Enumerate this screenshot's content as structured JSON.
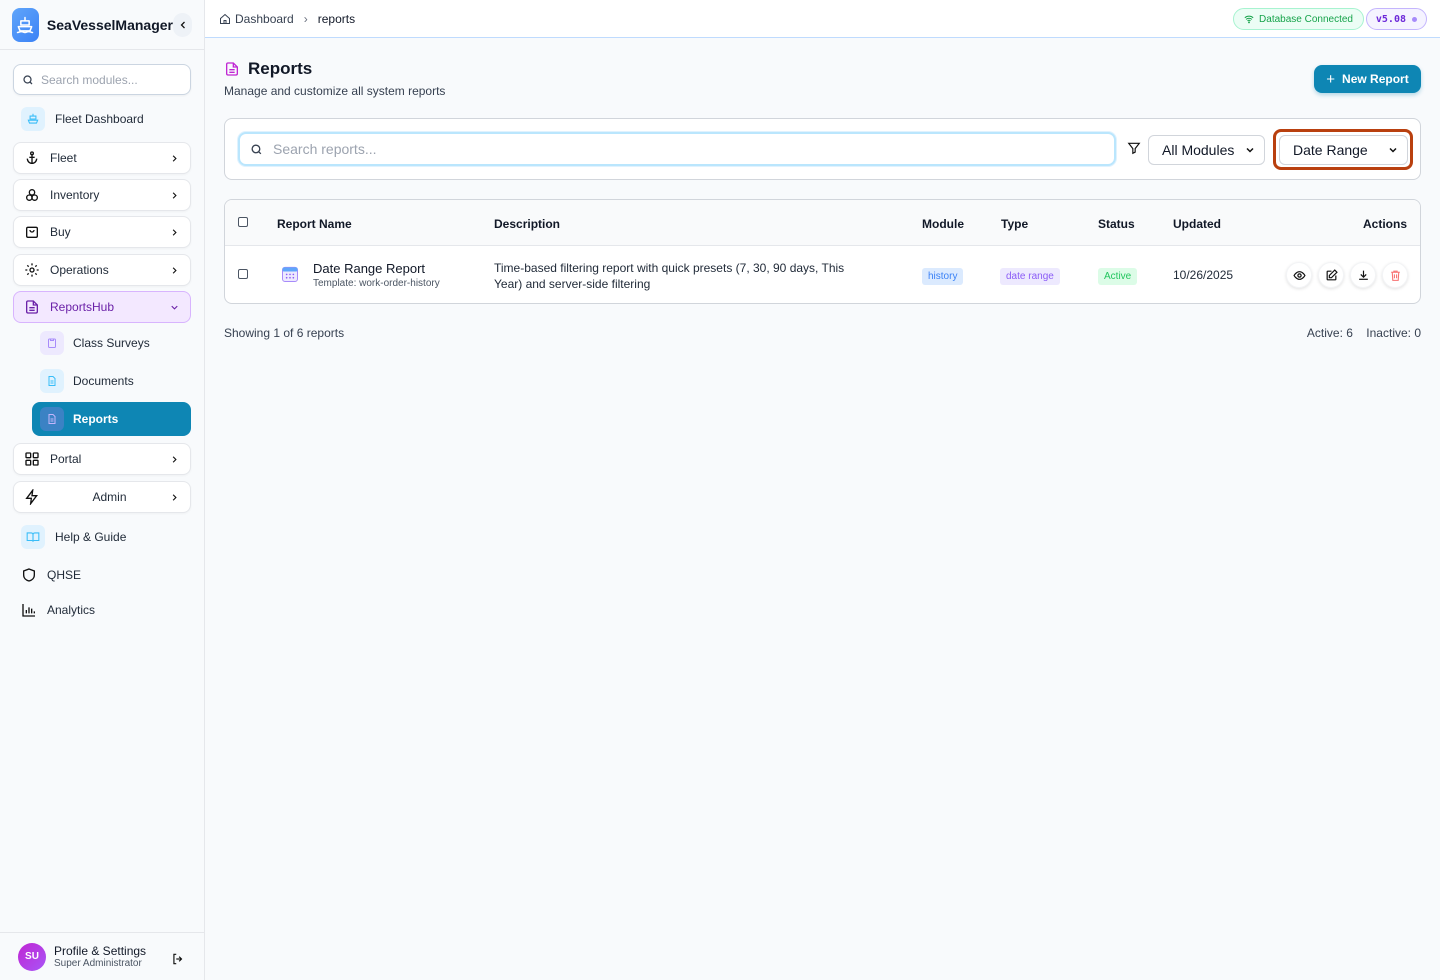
{
  "brand": {
    "name": "SeaVesselManager"
  },
  "sidebar": {
    "search_placeholder": "Search modules...",
    "items": [
      {
        "label": "Fleet Dashboard"
      },
      {
        "label": "Fleet"
      },
      {
        "label": "Inventory"
      },
      {
        "label": "Buy"
      },
      {
        "label": "Operations"
      },
      {
        "label": "ReportsHub"
      },
      {
        "label": "Portal"
      },
      {
        "label": "Admin"
      },
      {
        "label": "Help & Guide"
      },
      {
        "label": "QHSE"
      },
      {
        "label": "Analytics"
      }
    ],
    "subitems": [
      {
        "label": "Class Surveys"
      },
      {
        "label": "Documents"
      },
      {
        "label": "Reports"
      }
    ]
  },
  "profile": {
    "initials": "SU",
    "name": "Profile & Settings",
    "role": "Super Administrator"
  },
  "breadcrumb": {
    "home": "Dashboard",
    "current": "reports"
  },
  "status": {
    "db": "Database Connected",
    "version": "v5.08"
  },
  "page": {
    "title": "Reports",
    "subtitle": "Manage and customize all system reports",
    "new_button": "New Report"
  },
  "filters": {
    "search_placeholder": "Search reports...",
    "module_selected": "All Modules",
    "type_selected": "Date Range"
  },
  "table": {
    "headers": [
      "Report Name",
      "Description",
      "Module",
      "Type",
      "Status",
      "Updated",
      "Actions"
    ],
    "rows": [
      {
        "name": "Date Range Report",
        "template": "Template: work-order-history",
        "description_line1": "Time-based filtering report with quick presets (7, 30, 90 days, This",
        "description_line2": "Year) and server-side filtering",
        "module": "history",
        "type": "date range",
        "status": "Active",
        "updated": "10/26/2025"
      }
    ]
  },
  "footer": {
    "showing": "Showing 1 of 6 reports",
    "active": "Active: 6",
    "inactive": "Inactive: 0"
  },
  "colors": {
    "accent": "#0e86b4",
    "active_parent": "#f3e8ff",
    "highlight_outline": "#b9400f"
  }
}
